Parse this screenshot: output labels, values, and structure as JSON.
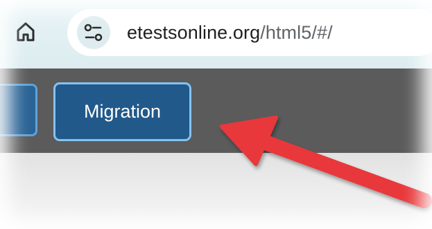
{
  "browser": {
    "address_bar": {
      "host": "etestsonline.org",
      "path": "/html5/#/"
    },
    "icons": {
      "home": "home-icon",
      "site_info": "tune-icon"
    }
  },
  "nav": {
    "active_button_label": "Migration"
  },
  "annotation": {
    "arrow_color": "#e8393a"
  },
  "colors": {
    "nav_bar": "#5b5b5b",
    "button_fill": "#21598a",
    "button_border": "#86c3ef",
    "browser_bar": "#e3f1f4"
  }
}
